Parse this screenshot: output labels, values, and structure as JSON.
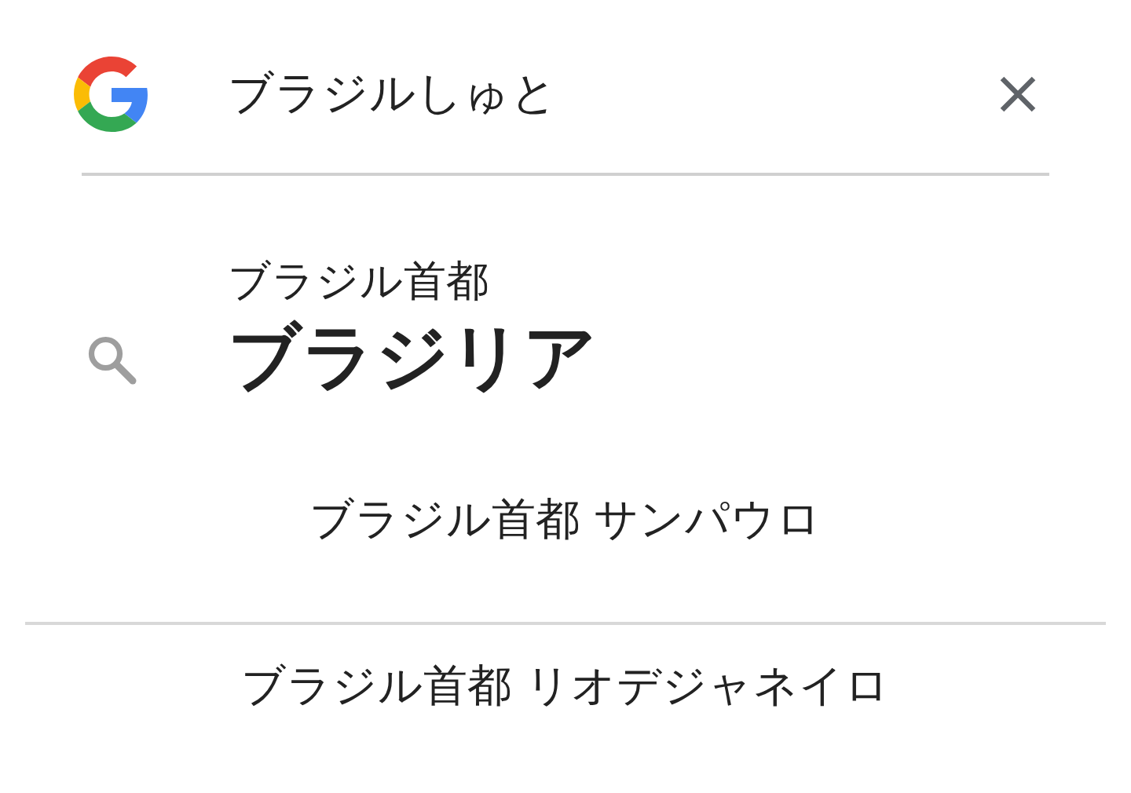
{
  "search": {
    "query": "ブラジルしゅと"
  },
  "answer": {
    "subtitle": "ブラジル首都",
    "title": "ブラジリア"
  },
  "suggestions": [
    {
      "label": "ブラジル首都 サンパウロ"
    },
    {
      "label": "ブラジル首都 リオデジャネイロ"
    }
  ]
}
